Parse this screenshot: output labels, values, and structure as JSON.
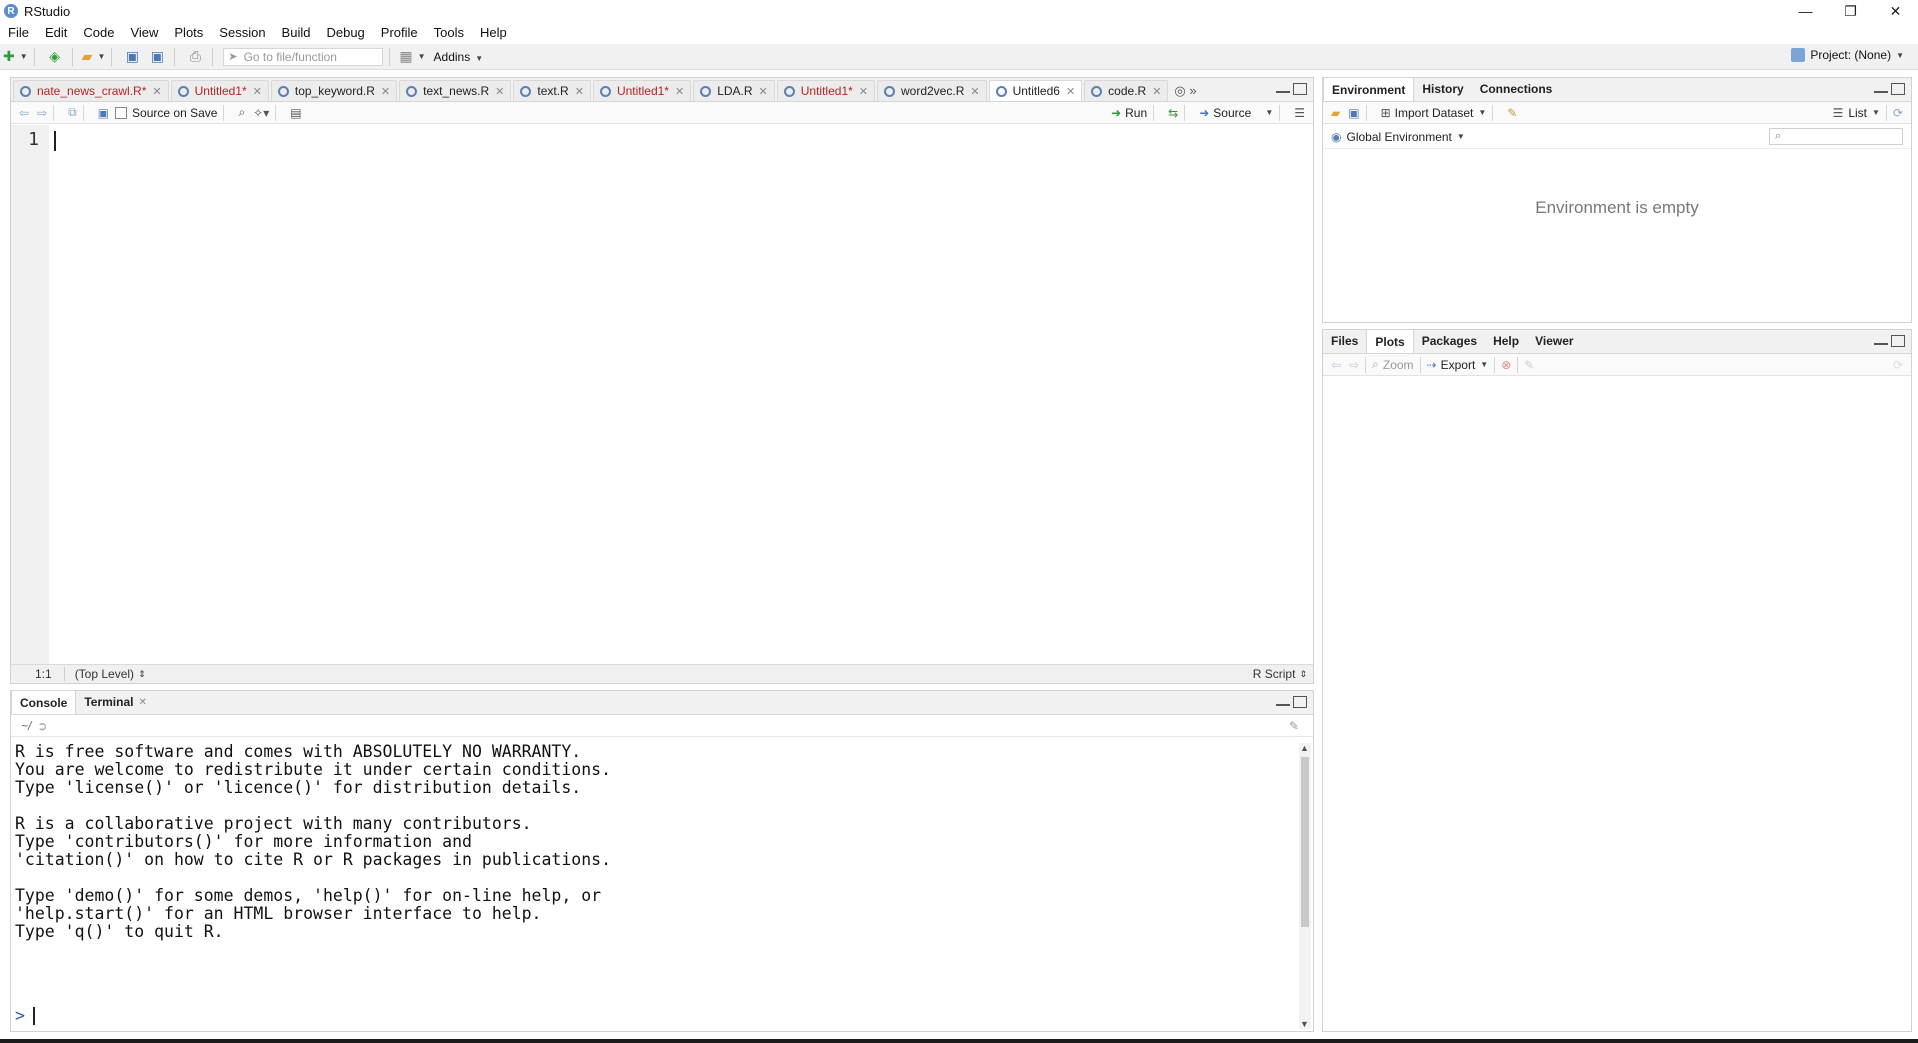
{
  "window": {
    "title": "RStudio",
    "controls": [
      "—",
      "❐",
      "✕"
    ]
  },
  "menu": [
    "File",
    "Edit",
    "Code",
    "View",
    "Plots",
    "Session",
    "Build",
    "Debug",
    "Profile",
    "Tools",
    "Help"
  ],
  "toolbar": {
    "goto_placeholder": "Go to file/function",
    "addins_label": "Addins",
    "project_label": "Project: (None)"
  },
  "editor": {
    "tabs": [
      {
        "label": "nate_news_crawl.R*",
        "modified": true
      },
      {
        "label": "Untitled1*",
        "modified": true
      },
      {
        "label": "top_keyword.R",
        "modified": false
      },
      {
        "label": "text_news.R",
        "modified": false
      },
      {
        "label": "text.R",
        "modified": false
      },
      {
        "label": "Untitled1*",
        "modified": true
      },
      {
        "label": "LDA.R",
        "modified": false
      },
      {
        "label": "Untitled1*",
        "modified": true
      },
      {
        "label": "word2vec.R",
        "modified": false
      },
      {
        "label": "Untitled6",
        "modified": false,
        "active": true
      },
      {
        "label": "code.R",
        "modified": false
      }
    ],
    "source_on_save_label": "Source on Save",
    "run_label": "Run",
    "source_label": "Source",
    "line_number": "1",
    "cursor_position": "1:1",
    "scope": "(Top Level)",
    "file_type": "R Script"
  },
  "console": {
    "tabs": [
      "Console",
      "Terminal"
    ],
    "path": "~/",
    "output": "R is free software and comes with ABSOLUTELY NO WARRANTY.\nYou are welcome to redistribute it under certain conditions.\nType 'license()' or 'licence()' for distribution details.\n\nR is a collaborative project with many contributors.\nType 'contributors()' for more information and\n'citation()' on how to cite R or R packages in publications.\n\nType 'demo()' for some demos, 'help()' for on-line help, or\n'help.start()' for an HTML browser interface to help.\nType 'q()' to quit R.",
    "prompt": ">"
  },
  "environment_pane": {
    "tabs": [
      "Environment",
      "History",
      "Connections"
    ],
    "import_label": "Import Dataset",
    "view_mode": "List",
    "scope_label": "Global Environment",
    "empty_text": "Environment is empty"
  },
  "files_pane": {
    "tabs": [
      "Files",
      "Plots",
      "Packages",
      "Help",
      "Viewer"
    ],
    "zoom_label": "Zoom",
    "export_label": "Export"
  }
}
